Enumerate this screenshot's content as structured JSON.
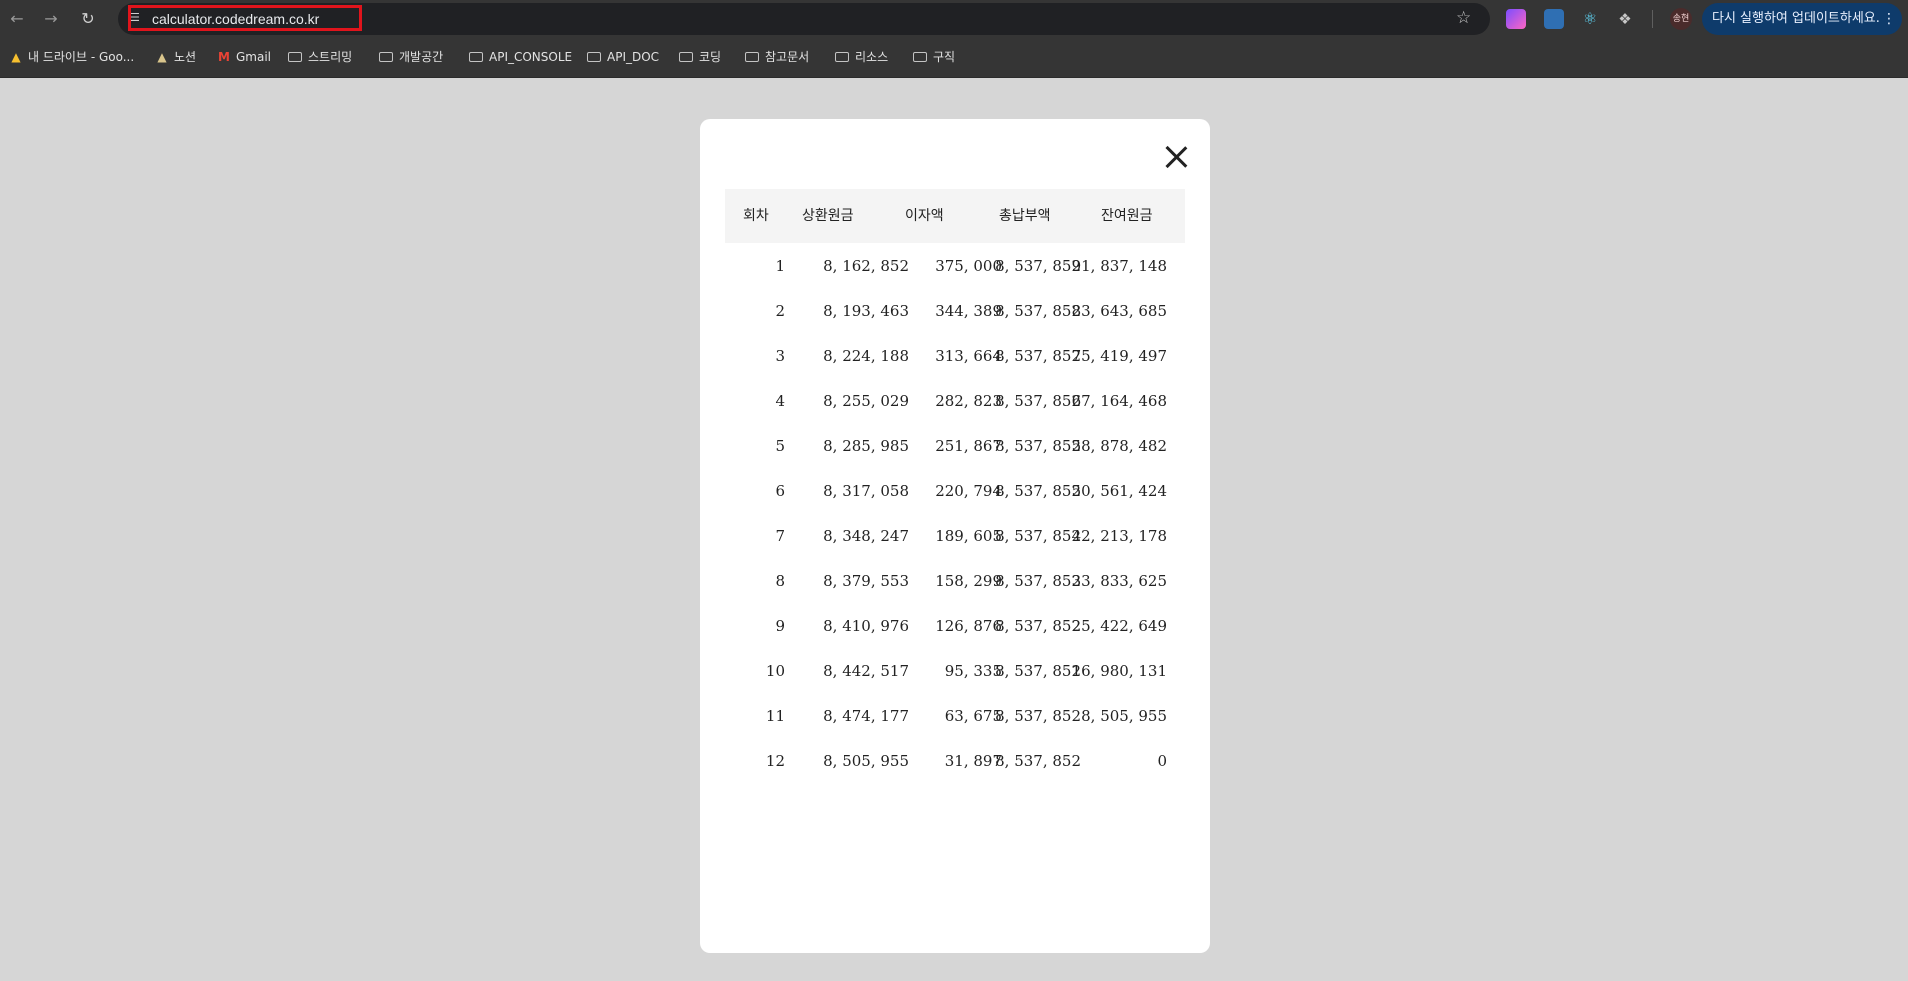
{
  "browser": {
    "url": "calculator.codedream.co.kr",
    "update_label": "다시 실행하여 업데이트하세요.",
    "profile_label": "송현"
  },
  "bookmarks": [
    {
      "label": "내 드라이브 - Goo...",
      "icon": "google-drive-icon"
    },
    {
      "label": "노션",
      "icon": "notion-icon"
    },
    {
      "label": "Gmail",
      "icon": "gmail-icon"
    },
    {
      "label": "스트리밍",
      "icon": "folder-icon"
    },
    {
      "label": "개발공간",
      "icon": "folder-icon"
    },
    {
      "label": "API_CONSOLE",
      "icon": "folder-icon"
    },
    {
      "label": "API_DOC",
      "icon": "folder-icon"
    },
    {
      "label": "코딩",
      "icon": "folder-icon"
    },
    {
      "label": "참고문서",
      "icon": "folder-icon"
    },
    {
      "label": "리소스",
      "icon": "folder-icon"
    },
    {
      "label": "구직",
      "icon": "folder-icon"
    }
  ],
  "table": {
    "headers": [
      "회차",
      "상환원금",
      "이자액",
      "총납부액",
      "잔여원금"
    ],
    "rows": [
      [
        "1",
        "8, 162, 852",
        "375, 000",
        "8, 537, 852",
        "91, 837, 148"
      ],
      [
        "2",
        "8, 193, 463",
        "344, 389",
        "8, 537, 852",
        "83, 643, 685"
      ],
      [
        "3",
        "8, 224, 188",
        "313, 664",
        "8, 537, 852",
        "75, 419, 497"
      ],
      [
        "4",
        "8, 255, 029",
        "282, 823",
        "8, 537, 852",
        "67, 164, 468"
      ],
      [
        "5",
        "8, 285, 985",
        "251, 867",
        "8, 537, 852",
        "58, 878, 482"
      ],
      [
        "6",
        "8, 317, 058",
        "220, 794",
        "8, 537, 852",
        "50, 561, 424"
      ],
      [
        "7",
        "8, 348, 247",
        "189, 605",
        "8, 537, 852",
        "42, 213, 178"
      ],
      [
        "8",
        "8, 379, 553",
        "158, 299",
        "8, 537, 852",
        "33, 833, 625"
      ],
      [
        "9",
        "8, 410, 976",
        "126, 876",
        "8, 537, 852",
        "25, 422, 649"
      ],
      [
        "10",
        "8, 442, 517",
        "95, 335",
        "8, 537, 852",
        "16, 980, 131"
      ],
      [
        "11",
        "8, 474, 177",
        "63, 675",
        "8, 537, 852",
        "8, 505, 955"
      ],
      [
        "12",
        "8, 505, 955",
        "31, 897",
        "8, 537, 852",
        "0"
      ]
    ]
  }
}
